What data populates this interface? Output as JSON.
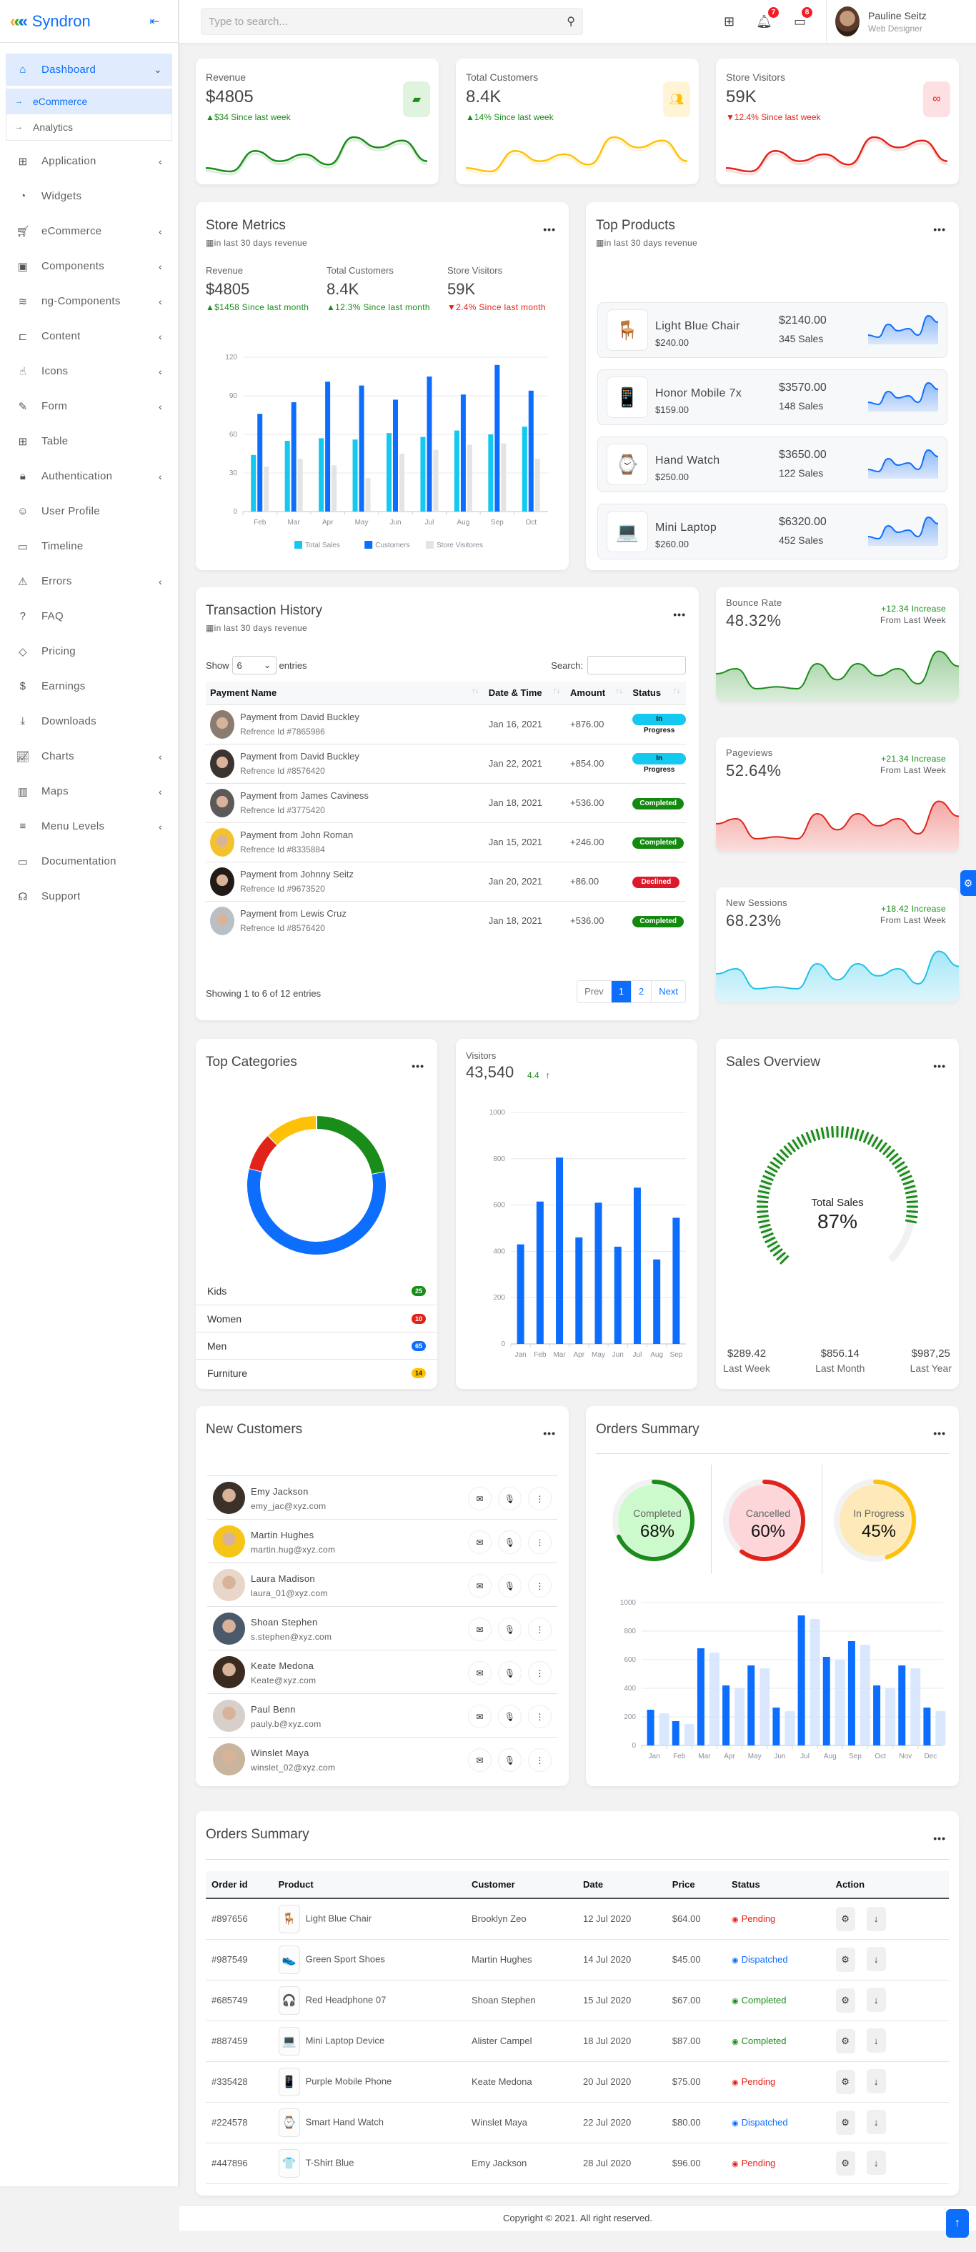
{
  "brand": {
    "name": "Syndron",
    "collapse_icon": "collapse-icon"
  },
  "sidebar": {
    "dashboard": {
      "label": "Dashboard",
      "icon": "home-icon"
    },
    "dashboard_sub": [
      {
        "label": "eCommerce",
        "active": true
      },
      {
        "label": "Analytics",
        "active": false
      }
    ],
    "items": [
      {
        "label": "Application",
        "icon": "grid-icon",
        "has_children": true
      },
      {
        "label": "Widgets",
        "icon": "cookie-icon",
        "has_children": false
      },
      {
        "label": "eCommerce",
        "icon": "cart-icon",
        "has_children": true
      },
      {
        "label": "Components",
        "icon": "bookmark-icon",
        "has_children": true
      },
      {
        "label": "ng-Components",
        "icon": "layers-icon",
        "has_children": true
      },
      {
        "label": "Content",
        "icon": "content-icon",
        "has_children": true
      },
      {
        "label": "Icons",
        "icon": "hand-icon",
        "has_children": true
      },
      {
        "label": "Form",
        "icon": "edit-icon",
        "has_children": true
      },
      {
        "label": "Table",
        "icon": "table-icon",
        "has_children": false
      },
      {
        "label": "Authentication",
        "icon": "lock-icon",
        "has_children": true
      },
      {
        "label": "User Profile",
        "icon": "user-circle-icon",
        "has_children": false
      },
      {
        "label": "Timeline",
        "icon": "video-icon",
        "has_children": false
      },
      {
        "label": "Errors",
        "icon": "warning-icon",
        "has_children": true
      },
      {
        "label": "FAQ",
        "icon": "question-icon",
        "has_children": false
      },
      {
        "label": "Pricing",
        "icon": "diamond-icon",
        "has_children": false
      },
      {
        "label": "Earnings",
        "icon": "dollar-icon",
        "has_children": false
      },
      {
        "label": "Downloads",
        "icon": "download-icon",
        "has_children": false
      },
      {
        "label": "Charts",
        "icon": "chart-icon",
        "has_children": true
      },
      {
        "label": "Maps",
        "icon": "map-icon",
        "has_children": true
      },
      {
        "label": "Menu Levels",
        "icon": "menu-icon",
        "has_children": true
      },
      {
        "label": "Documentation",
        "icon": "folder-icon",
        "has_children": false
      },
      {
        "label": "Support",
        "icon": "headset-icon",
        "has_children": false
      }
    ]
  },
  "topbar": {
    "search_placeholder": "Type to search...",
    "notifications_count": "7",
    "messages_count": "8",
    "user_name": "Pauline Seitz",
    "user_role": "Web Designer"
  },
  "stats": [
    {
      "title": "Revenue",
      "value": "$4805",
      "change": "▲$34 Since last week",
      "trend": "up",
      "color": "#198c19",
      "icon": "wallet-icon"
    },
    {
      "title": "Total Customers",
      "value": "8.4K",
      "change": "▲14% Since last week",
      "trend": "up",
      "color": "#ffc107",
      "icon": "users-icon"
    },
    {
      "title": "Store Visitors",
      "value": "59K",
      "change": "▼12.4% Since last week",
      "trend": "down",
      "color": "#e2231a",
      "icon": "binoculars-icon"
    }
  ],
  "store_metrics": {
    "title": "Store Metrics",
    "subtitle": "in last 30 days revenue",
    "kpis": [
      {
        "label": "Revenue",
        "value": "$4805",
        "change": "▲$1458 Since last month",
        "trend": "up"
      },
      {
        "label": "Total Customers",
        "value": "8.4K",
        "change": "▲12.3% Since last month",
        "trend": "up"
      },
      {
        "label": "Store Visitors",
        "value": "59K",
        "change": "▼2.4% Since last month",
        "trend": "down"
      }
    ]
  },
  "top_products": {
    "title": "Top Products",
    "subtitle": "in last 30 days revenue",
    "items": [
      {
        "name": "Light Blue Chair",
        "price": "$240.00",
        "total": "$2140.00",
        "sales": "345 Sales",
        "icon": "chair-icon",
        "glyph": "🪑"
      },
      {
        "name": "Honor Mobile 7x",
        "price": "$159.00",
        "total": "$3570.00",
        "sales": "148 Sales",
        "icon": "mobile-icon",
        "glyph": "📱"
      },
      {
        "name": "Hand Watch",
        "price": "$250.00",
        "total": "$3650.00",
        "sales": "122 Sales",
        "icon": "watch-icon",
        "glyph": "⌚"
      },
      {
        "name": "Mini Laptop",
        "price": "$260.00",
        "total": "$6320.00",
        "sales": "452 Sales",
        "icon": "laptop-icon",
        "glyph": "💻"
      }
    ]
  },
  "transactions": {
    "title": "Transaction History",
    "subtitle": "in last 30 days revenue",
    "show_label": "Show",
    "entries_value": "6",
    "entries_label": "entries",
    "search_label": "Search:",
    "search_value": "",
    "columns": [
      "Payment Name",
      "Date & Time",
      "Amount",
      "Status"
    ],
    "rows": [
      {
        "name": "Payment from David Buckley",
        "ref": "Refrence Id #7865986",
        "date": "Jan 16, 2021",
        "amount": "+876.00",
        "status": "In Progress"
      },
      {
        "name": "Payment from David Buckley",
        "ref": "Refrence Id #8576420",
        "date": "Jan 22, 2021",
        "amount": "+854.00",
        "status": "In Progress"
      },
      {
        "name": "Payment from James Caviness",
        "ref": "Refrence Id #3775420",
        "date": "Jan 18, 2021",
        "amount": "+536.00",
        "status": "Completed"
      },
      {
        "name": "Payment from John Roman",
        "ref": "Refrence Id #8335884",
        "date": "Jan 15, 2021",
        "amount": "+246.00",
        "status": "Completed"
      },
      {
        "name": "Payment from Johnny Seitz",
        "ref": "Refrence Id #9673520",
        "date": "Jan 20, 2021",
        "amount": "+86.00",
        "status": "Declined"
      },
      {
        "name": "Payment from Lewis Cruz",
        "ref": "Refrence Id #8576420",
        "date": "Jan 18, 2021",
        "amount": "+536.00",
        "status": "Completed"
      }
    ],
    "info": "Showing 1 to 6 of 12 entries",
    "pagination": {
      "prev": "Prev",
      "pages": [
        "1",
        "2"
      ],
      "current": "1",
      "next": "Next"
    }
  },
  "mini_stats": [
    {
      "title": "Bounce Rate",
      "value": "48.32%",
      "change": "+12.34 Increase",
      "note": "From Last Week",
      "color": "#198c19"
    },
    {
      "title": "Pageviews",
      "value": "52.64%",
      "change": "+21.34 Increase",
      "note": "From Last Week",
      "color": "#e2231a"
    },
    {
      "title": "New Sessions",
      "value": "68.23%",
      "change": "+18.42 Increase",
      "note": "From Last Week",
      "color": "#1ec2e8"
    }
  ],
  "top_categories": {
    "title": "Top Categories",
    "items": [
      {
        "label": "Kids",
        "count": "25",
        "color": "#198c19"
      },
      {
        "label": "Women",
        "count": "10",
        "color": "#e2231a"
      },
      {
        "label": "Men",
        "count": "65",
        "color": "#0d6efd"
      },
      {
        "label": "Furniture",
        "count": "14",
        "color": "#ffc107"
      }
    ]
  },
  "visitors": {
    "title": "Visitors",
    "value": "43,540",
    "change": "4.4"
  },
  "sales_overview": {
    "title": "Sales Overview",
    "center_label": "Total Sales",
    "center_value": "87%",
    "progress": 0.87,
    "footer": [
      {
        "value": "$289.42",
        "label": "Last Week"
      },
      {
        "value": "$856.14",
        "label": "Last Month"
      },
      {
        "value": "$987,25",
        "label": "Last Year"
      }
    ]
  },
  "new_customers": {
    "title": "New Customers",
    "items": [
      {
        "name": "Emy Jackson",
        "email": "emy_jac@xyz.com"
      },
      {
        "name": "Martin Hughes",
        "email": "martin.hug@xyz.com"
      },
      {
        "name": "Laura Madison",
        "email": "laura_01@xyz.com"
      },
      {
        "name": "Shoan Stephen",
        "email": "s.stephen@xyz.com"
      },
      {
        "name": "Keate Medona",
        "email": "Keate@xyz.com"
      },
      {
        "name": "Paul Benn",
        "email": "pauly.b@xyz.com"
      },
      {
        "name": "Winslet Maya",
        "email": "winslet_02@xyz.com"
      }
    ]
  },
  "orders_summary_chart": {
    "title": "Orders Summary",
    "rings": [
      {
        "label": "Completed",
        "value": "68%",
        "fraction": 0.68,
        "color": "#198c19",
        "bg": "#cdfacc"
      },
      {
        "label": "Cancelled",
        "value": "60%",
        "fraction": 0.6,
        "color": "#e2231a",
        "bg": "#fdd6da"
      },
      {
        "label": "In Progress",
        "value": "45%",
        "fraction": 0.45,
        "color": "#ffc107",
        "bg": "#fdeab8"
      }
    ]
  },
  "orders_table": {
    "title": "Orders Summary",
    "columns": [
      "Order id",
      "Product",
      "Customer",
      "Date",
      "Price",
      "Status",
      "Action"
    ],
    "rows": [
      {
        "id": "#897656",
        "product": "Light Blue Chair",
        "glyph": "🪑",
        "customer": "Brooklyn Zeo",
        "date": "12 Jul 2020",
        "price": "$64.00",
        "status": "Pending"
      },
      {
        "id": "#987549",
        "product": "Green Sport Shoes",
        "glyph": "👟",
        "customer": "Martin Hughes",
        "date": "14 Jul 2020",
        "price": "$45.00",
        "status": "Dispatched"
      },
      {
        "id": "#685749",
        "product": "Red Headphone 07",
        "glyph": "🎧",
        "customer": "Shoan Stephen",
        "date": "15 Jul 2020",
        "price": "$67.00",
        "status": "Completed"
      },
      {
        "id": "#887459",
        "product": "Mini Laptop Device",
        "glyph": "💻",
        "customer": "Alister Campel",
        "date": "18 Jul 2020",
        "price": "$87.00",
        "status": "Completed"
      },
      {
        "id": "#335428",
        "product": "Purple Mobile Phone",
        "glyph": "📱",
        "customer": "Keate Medona",
        "date": "20 Jul 2020",
        "price": "$75.00",
        "status": "Pending"
      },
      {
        "id": "#224578",
        "product": "Smart Hand Watch",
        "glyph": "⌚",
        "customer": "Winslet Maya",
        "date": "22 Jul 2020",
        "price": "$80.00",
        "status": "Dispatched"
      },
      {
        "id": "#447896",
        "product": "T-Shirt Blue",
        "glyph": "👕",
        "customer": "Emy Jackson",
        "date": "28 Jul 2020",
        "price": "$96.00",
        "status": "Pending"
      }
    ]
  },
  "footer": {
    "copyright": "Copyright © 2021. All right reserved."
  },
  "status_colors": {
    "In Progress": "#14c8ef",
    "Completed": "#13890f",
    "Declined": "#dc1a2a",
    "Pending": "#e2231a",
    "Dispatched": "#0d6efd",
    "CompletedText": "#198c19"
  },
  "chart_data": [
    {
      "type": "bar",
      "id": "store-metrics",
      "categories": [
        "Feb",
        "Mar",
        "Apr",
        "May",
        "Jun",
        "Jul",
        "Aug",
        "Sep",
        "Oct"
      ],
      "series": [
        {
          "name": "Total Sales",
          "color": "#14c8ef",
          "values": [
            44,
            55,
            57,
            56,
            61,
            58,
            63,
            60,
            66
          ]
        },
        {
          "name": "Customers",
          "color": "#0d6efd",
          "values": [
            76,
            85,
            101,
            98,
            87,
            105,
            91,
            114,
            94
          ]
        },
        {
          "name": "Store Visitores",
          "color": "#e4e4e4",
          "values": [
            35,
            41,
            36,
            26,
            45,
            48,
            52,
            53,
            41
          ]
        }
      ],
      "ylim": [
        0,
        120
      ],
      "yticks": [
        0,
        30,
        60,
        90,
        120
      ],
      "legend": "bottom",
      "grid": true
    },
    {
      "type": "bar",
      "id": "visitors",
      "categories": [
        "Jan",
        "Feb",
        "Mar",
        "Apr",
        "May",
        "Jun",
        "Jul",
        "Aug",
        "Sep"
      ],
      "series": [
        {
          "name": "Visitors",
          "color": "#0d6efd",
          "values": [
            430,
            615,
            805,
            460,
            610,
            420,
            675,
            365,
            545
          ]
        }
      ],
      "ylim": [
        0,
        1000
      ],
      "yticks": [
        0,
        200,
        400,
        600,
        800,
        1000
      ],
      "grid": true
    },
    {
      "type": "bar",
      "id": "orders-summary",
      "categories": [
        "Jan",
        "Feb",
        "Mar",
        "Apr",
        "May",
        "Jun",
        "Jul",
        "Aug",
        "Sep",
        "Oct",
        "Nov",
        "Dec"
      ],
      "series": [
        {
          "name": "Orders",
          "color": "#0d6efd",
          "values": [
            250,
            170,
            680,
            420,
            560,
            265,
            910,
            620,
            730,
            420,
            560,
            265
          ]
        },
        {
          "name": "Orders (shadow)",
          "color": "#cfe2ff",
          "values": [
            225,
            150,
            650,
            400,
            540,
            240,
            885,
            600,
            705,
            400,
            540,
            240
          ]
        }
      ],
      "ylim": [
        0,
        1000
      ],
      "yticks": [
        0,
        200,
        400,
        600,
        800,
        1000
      ],
      "grid": true
    },
    {
      "type": "pie",
      "id": "top-categories",
      "labels": [
        "Kids",
        "Men",
        "Women",
        "Furniture"
      ],
      "values": [
        25,
        65,
        10,
        14
      ],
      "colors": [
        "#198c19",
        "#0d6efd",
        "#e2231a",
        "#ffc107"
      ],
      "donut": true
    },
    {
      "type": "line",
      "id": "sparkline",
      "values": [
        3,
        2,
        8,
        5,
        7,
        4,
        12,
        9,
        11,
        5
      ],
      "note": "shared wave shape used by stat cards and product sparklines"
    },
    {
      "type": "area",
      "id": "mini-area",
      "values": [
        5,
        6,
        2,
        2.4,
        2,
        7,
        3.8,
        7,
        4.6,
        6,
        3,
        9.5,
        6.5
      ]
    }
  ]
}
